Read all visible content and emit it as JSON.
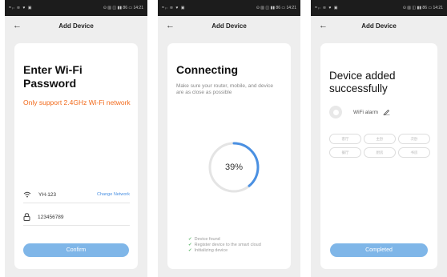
{
  "status_bar": {
    "left": "ᵐᵢₗ ≋ ♥ ▣",
    "right": "⊙ ▥ ◫ ▮▮ 86 ▭ 14:21"
  },
  "screen1": {
    "header_title": "Add Device",
    "title_line1": "Enter Wi-Fi",
    "title_line2": "Password",
    "note": "Only support 2.4GHz Wi-Fi network",
    "wifi_name": "YH-123",
    "change_network": "Change Network",
    "password": "123456789",
    "confirm_label": "Confirm"
  },
  "screen2": {
    "header_title": "Add Device",
    "title": "Connecting",
    "subtitle": "Make sure your router, mobile, and device are as close as possible",
    "progress_percent": 39,
    "progress_label": "39%",
    "steps": [
      "Device found",
      "Register device to the smart cloud",
      "Initializing device"
    ]
  },
  "screen3": {
    "header_title": "Add Device",
    "title_line1": "Device added",
    "title_line2": "successfully",
    "device_name": "WiFi alarm",
    "rooms": [
      "客厅",
      "主卧",
      "次卧",
      "餐厅",
      "厨房",
      "书房"
    ],
    "completed_label": "Completed"
  },
  "colors": {
    "accent_blue": "#7fb6e8",
    "link_blue": "#4a90e2",
    "warning_orange": "#f26a1b",
    "progress_blue": "#4a90e2",
    "check_green": "#6fc07a"
  }
}
